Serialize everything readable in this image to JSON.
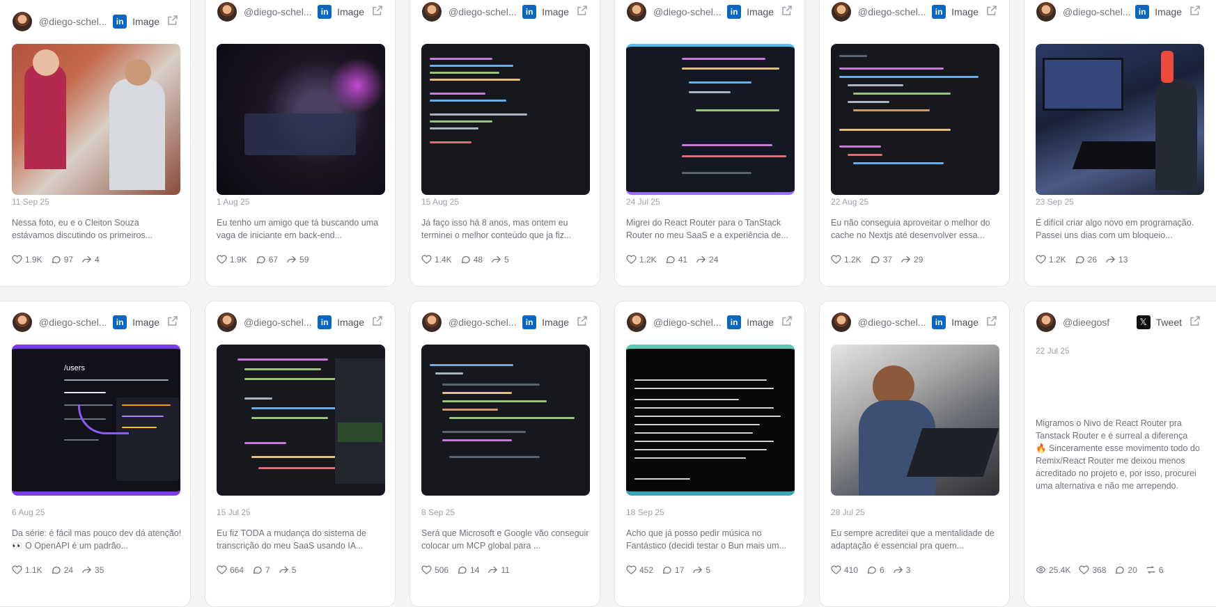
{
  "cards": [
    {
      "user": "@diego-schel...",
      "kind": "Image",
      "platform": "linkedin",
      "date": "11 Sep 25",
      "text": "Nessa foto, eu e o Cleiton Souza estávamos discutindo os primeiros...",
      "likes": "1.9K",
      "comments": "97",
      "shares": "4",
      "image": "photo-two-people"
    },
    {
      "user": "@diego-schel...",
      "kind": "Image",
      "platform": "linkedin",
      "date": "1 Aug 25",
      "text": "Eu tenho um amigo que tá buscando uma vaga de iniciante em back-end...",
      "likes": "1.9K",
      "comments": "67",
      "shares": "59",
      "image": "photo-dark-setup"
    },
    {
      "user": "@diego-schel...",
      "kind": "Image",
      "platform": "linkedin",
      "date": "15 Aug 25",
      "text": "Já faço isso há 8 anos, mas ontem eu terminei o melhor conteúdo que ja fiz...",
      "likes": "1.4K",
      "comments": "48",
      "shares": "5",
      "image": "screenshot-code-editor"
    },
    {
      "user": "@diego-schel...",
      "kind": "Image",
      "platform": "linkedin",
      "date": "24 Jul 25",
      "text": "Migrei do React Router para o TanStack Router no meu SaaS e a experiência de...",
      "likes": "1.2K",
      "comments": "41",
      "shares": "24",
      "image": "screenshot-route-code"
    },
    {
      "user": "@diego-schel...",
      "kind": "Image",
      "platform": "linkedin",
      "date": "22 Aug 25",
      "text": "Eu não conseguia aproveitar o melhor do cache no Nextjs até desenvolver essa...",
      "likes": "1.2K",
      "comments": "37",
      "shares": "29",
      "image": "screenshot-nextjs-code"
    },
    {
      "user": "@diego-schel...",
      "kind": "Image",
      "platform": "linkedin",
      "date": "23 Sep 25",
      "text": "É difícil criar algo novo em programação.  Passei uns dias com um bloqueio...",
      "likes": "1.2K",
      "comments": "26",
      "shares": "13",
      "image": "photo-desk"
    },
    {
      "user": "@diego-schel...",
      "kind": "Image",
      "platform": "linkedin",
      "date": "6 Aug 25",
      "text": "Da série: é fácil mas pouco dev dá atenção! 👀   O OpenAPI é um padrão...",
      "likes": "1.1K",
      "comments": "24",
      "shares": "35",
      "image": "screenshot-openapi"
    },
    {
      "user": "@diego-schel...",
      "kind": "Image",
      "platform": "linkedin",
      "date": "15 Jul 25",
      "text": "Eu fiz TODA a mudança do sistema de transcrição do meu SaaS usando IA...",
      "likes": "664",
      "comments": "7",
      "shares": "5",
      "image": "screenshot-python-code"
    },
    {
      "user": "@diego-schel...",
      "kind": "Image",
      "platform": "linkedin",
      "date": "8 Sep 25",
      "text": "Será que Microsoft e Google vão conseguir colocar um MCP global para ...",
      "likes": "506",
      "comments": "14",
      "shares": "11",
      "image": "screenshot-mcp-code"
    },
    {
      "user": "@diego-schel...",
      "kind": "Image",
      "platform": "linkedin",
      "date": "18 Sep 25",
      "text": "Acho que já posso pedir música no Fantástico (decidi testar o Bun mais um...",
      "likes": "452",
      "comments": "17",
      "shares": "5",
      "image": "screenshot-terminal"
    },
    {
      "user": "@diego-schel...",
      "kind": "Image",
      "platform": "linkedin",
      "date": "28 Jul 25",
      "text": "Eu sempre acreditei que a mentalidade de adaptação é essencial pra quem...",
      "likes": "410",
      "comments": "6",
      "shares": "3",
      "image": "photo-kid-laptop"
    },
    {
      "user": "@dieegosf",
      "kind": "Tweet",
      "platform": "x",
      "date": "22 Jul 25",
      "text": "Migramos o Nivo de React Router pra Tanstack Router e é surreal a diferença 🔥 Sinceramente esse movimento todo do Remix/React Router me deixou menos acreditado no projeto e, por isso, procurei uma alternativa e não me arrependo.",
      "views": "25.4K",
      "likes": "368",
      "comments": "20",
      "shares": "6"
    }
  ],
  "colors": {
    "linkedin": "#0a66c2",
    "x": "#111111",
    "card_bg": "#ffffff",
    "page_bg": "#f4f4f5",
    "muted": "#71717a"
  }
}
